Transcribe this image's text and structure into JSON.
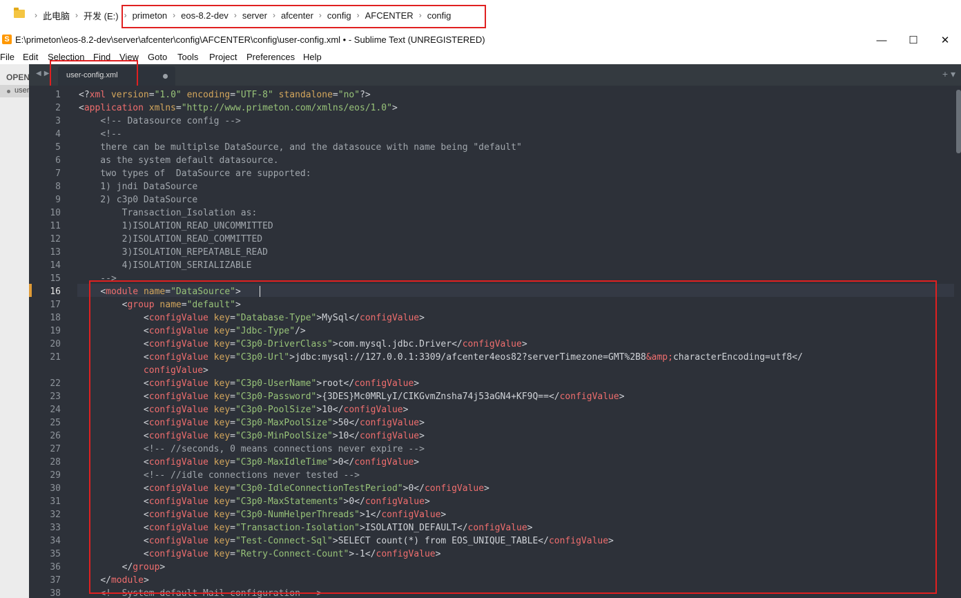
{
  "explorer": {
    "path": [
      "此电脑",
      "开发 (E:)",
      "primeton",
      "eos-8.2-dev",
      "server",
      "afcenter",
      "config",
      "AFCENTER",
      "config"
    ],
    "separator": "›"
  },
  "window": {
    "title": "E:\\primeton\\eos-8.2-dev\\server\\afcenter\\config\\AFCENTER\\config\\user-config.xml • - Sublime Text (UNREGISTERED)",
    "minimize": "—",
    "maximize": "☐",
    "close": "✕"
  },
  "menu": [
    "File",
    "Edit",
    "Selection",
    "Find",
    "View",
    "Goto",
    "Tools",
    "Project",
    "Preferences",
    "Help"
  ],
  "sidebar": {
    "open_label": "OPEN",
    "file_label": "user"
  },
  "tabs": [
    {
      "label": "user-config.xml",
      "modified": true
    }
  ],
  "editor": {
    "current_line": 16,
    "line_numbers": [
      "1",
      "2",
      "3",
      "4",
      "5",
      "6",
      "7",
      "8",
      "9",
      "10",
      "11",
      "12",
      "13",
      "14",
      "15",
      "16",
      "17",
      "18",
      "19",
      "20",
      "21",
      "",
      "22",
      "23",
      "24",
      "25",
      "26",
      "27",
      "28",
      "29",
      "30",
      "31",
      "32",
      "33",
      "34",
      "35",
      "36",
      "37",
      "38"
    ],
    "lines": [
      "<?xml version=\"1.0\" encoding=\"UTF-8\" standalone=\"no\"?>",
      "<application xmlns=\"http://www.primeton.com/xmlns/eos/1.0\">",
      "    <!-- Datasource config -->",
      "    <!--",
      "    there can be multiplse DataSource, and the datasouce with name being \"default\"",
      "    as the system default datasource.",
      "    two types of  DataSource are supported:",
      "    1) jndi DataSource",
      "    2) c3p0 DataSource",
      "        Transaction_Isolation as:",
      "        1)ISOLATION_READ_UNCOMMITTED",
      "        2)ISOLATION_READ_COMMITTED",
      "        3)ISOLATION_REPEATABLE_READ",
      "        4)ISOLATION_SERIALIZABLE",
      "    -->",
      "    <module name=\"DataSource\">",
      "        <group name=\"default\">",
      "            <configValue key=\"Database-Type\">MySql</configValue>",
      "            <configValue key=\"Jdbc-Type\"/>",
      "            <configValue key=\"C3p0-DriverClass\">com.mysql.jdbc.Driver</configValue>",
      "            <configValue key=\"C3p0-Url\">jdbc:mysql://127.0.0.1:3309/afcenter4eos82?serverTimezone=GMT%2B8&amp;characterEncoding=utf8</",
      "            configValue>",
      "            <configValue key=\"C3p0-UserName\">root</configValue>",
      "            <configValue key=\"C3p0-Password\">{3DES}Mc0MRLyI/CIKGvmZnsha74j53aGN4+KF9Q==</configValue>",
      "            <configValue key=\"C3p0-PoolSize\">10</configValue>",
      "            <configValue key=\"C3p0-MaxPoolSize\">50</configValue>",
      "            <configValue key=\"C3p0-MinPoolSize\">10</configValue>",
      "            <!-- //seconds, 0 means connections never expire -->",
      "            <configValue key=\"C3p0-MaxIdleTime\">0</configValue>",
      "            <!-- //idle connections never tested -->",
      "            <configValue key=\"C3p0-IdleConnectionTestPeriod\">0</configValue>",
      "            <configValue key=\"C3p0-MaxStatements\">0</configValue>",
      "            <configValue key=\"C3p0-NumHelperThreads\">1</configValue>",
      "            <configValue key=\"Transaction-Isolation\">ISOLATION_DEFAULT</configValue>",
      "            <configValue key=\"Test-Connect-Sql\">SELECT count(*) from EOS_UNIQUE_TABLE</configValue>",
      "            <configValue key=\"Retry-Connect-Count\">-1</configValue>",
      "        </group>",
      "    </module>",
      "    <!--System default Mail configuration -->"
    ]
  },
  "colors": {
    "tag": "#f06e6e",
    "attribute": "#d3a65c",
    "string": "#98c379",
    "comment": "#a1a7ad",
    "annotation_box": "#e02020",
    "editor_background": "#2d3139"
  }
}
